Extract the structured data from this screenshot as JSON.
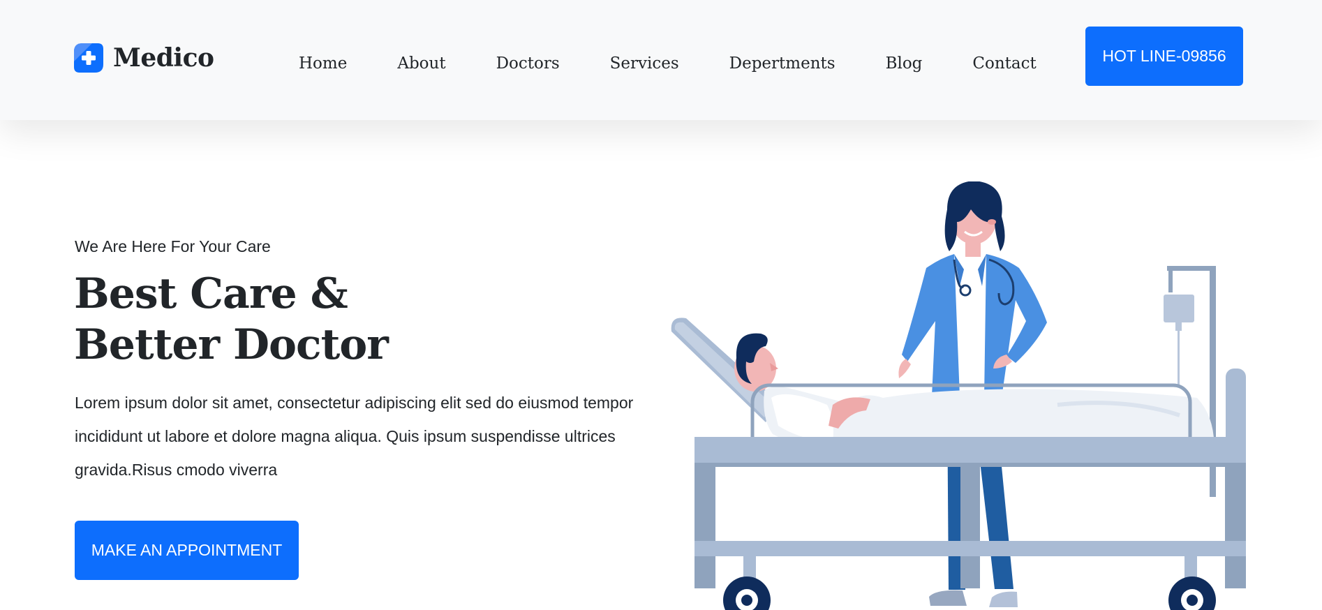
{
  "brand": {
    "name": "Medico",
    "icon": "medical-cross-icon"
  },
  "nav": {
    "items": [
      {
        "label": "Home"
      },
      {
        "label": "About"
      },
      {
        "label": "Doctors"
      },
      {
        "label": "Services"
      },
      {
        "label": "Depertments"
      },
      {
        "label": "Blog"
      },
      {
        "label": "Contact"
      }
    ],
    "hotline_label": "HOT LINE-09856"
  },
  "hero": {
    "eyebrow": "We Are Here For Your Care",
    "title_line1": "Best Care &",
    "title_line2": "Better Doctor",
    "description": "Lorem ipsum dolor sit amet, consectetur adipiscing elit sed do eiusmod tempor incididunt ut labore et dolore magna aliqua. Quis ipsum suspendisse ultrices gravida.Risus cmodo viverra",
    "cta_label": "MAKE AN APPOINTMENT"
  },
  "colors": {
    "primary": "#0d6efd",
    "navbar_bg": "#f8f9fa",
    "text": "#212529",
    "doctor_coat": "#4a90e2",
    "bed_frame": "#a9bbd4",
    "hair": "#0f2c5c"
  }
}
